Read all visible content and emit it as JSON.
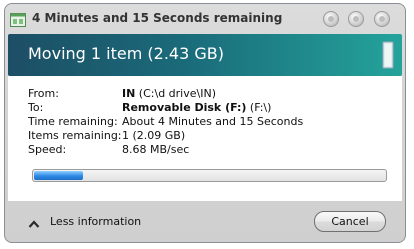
{
  "window": {
    "title": "4 Minutes and 15 Seconds remaining",
    "header": "Moving 1 item (2.43 GB)"
  },
  "details": {
    "from_label": "From:",
    "from_name": "IN",
    "from_path": " (C:\\d drive\\IN)",
    "to_label": "To:",
    "to_name": "Removable Disk (F:)",
    "to_path": " (F:\\)",
    "time_label": "Time remaining:",
    "time_value": "About 4 Minutes and 15 Seconds",
    "items_label": "Items remaining:",
    "items_value": "1 (2.09 GB)",
    "speed_label": "Speed:",
    "speed_value": "8.68 MB/sec"
  },
  "progress": {
    "fraction": 0.14
  },
  "footer": {
    "less_info": "Less information",
    "cancel": "Cancel"
  },
  "icons": {
    "title": "copy-dialog-icon",
    "header": "removable-drive-icon",
    "less": "chevron-up-icon"
  },
  "colors": {
    "header_start": "#1d4e65",
    "header_end": "#24a39b",
    "progress_fill": "#2d89e6"
  }
}
